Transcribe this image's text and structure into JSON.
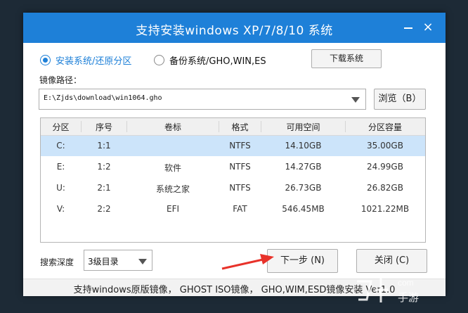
{
  "window": {
    "title": "支持安装windows XP/7/8/10 系统",
    "minimize_icon": "minimize-icon",
    "close_icon": "close-icon",
    "close_glyph": "×"
  },
  "mode": {
    "option_install": "安装系统/还原分区",
    "option_backup": "备份系统/GHO,WIN,ES",
    "selected": "option_install"
  },
  "download_label": "下载系统",
  "image_path": {
    "label": "镜像路径：",
    "value": "E:\\Zjds\\download\\win1064.gho"
  },
  "browse_label": "浏览（B）",
  "table": {
    "headers": [
      "分区",
      "序号",
      "卷标",
      "格式",
      "可用空间",
      "分区容量"
    ],
    "rows": [
      [
        "C:",
        "1:1",
        "",
        "NTFS",
        "14.10GB",
        "35.00GB"
      ],
      [
        "E:",
        "1:2",
        "软件",
        "NTFS",
        "14.27GB",
        "24.99GB"
      ],
      [
        "U:",
        "2:1",
        "系统之家",
        "NTFS",
        "26.73GB",
        "26.82GB"
      ],
      [
        "V:",
        "2:2",
        "EFI",
        "FAT",
        "546.45MB",
        "1021.22MB"
      ]
    ],
    "selected_row": 0
  },
  "search_depth": {
    "label": "搜索深度",
    "value": "3级目录"
  },
  "next_label": "下一步 (N)",
  "close_label": "关闭 (C)",
  "footer": "支持windows原版镜像， GHOST ISO镜像， GHO,WIM,ESD镜像安装 Ver1.0",
  "colors": {
    "accent": "#1e80d8",
    "selected_row": "#cce4fa",
    "annotation_arrow": "#e8322a"
  }
}
